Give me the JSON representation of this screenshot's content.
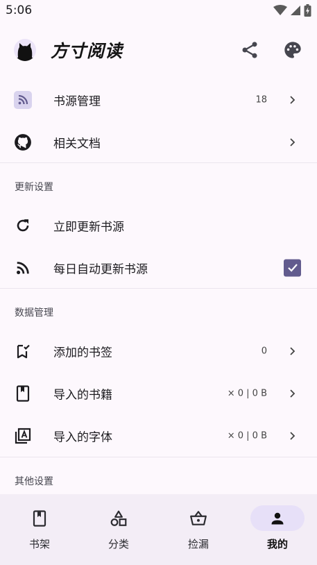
{
  "status_bar": {
    "time": "5:06"
  },
  "app": {
    "title": "方寸阅读"
  },
  "rows": {
    "book_source": {
      "label": "书源管理",
      "value": "18"
    },
    "docs": {
      "label": "相关文档"
    },
    "update_now": {
      "label": "立即更新书源"
    },
    "daily_update": {
      "label": "每日自动更新书源",
      "checked": true
    },
    "bookmarks": {
      "label": "添加的书签",
      "value": "0"
    },
    "imported_books": {
      "label": "导入的书籍",
      "value": "× 0 | 0 B"
    },
    "imported_fonts": {
      "label": "导入的字体",
      "value": "× 0 | 0 B"
    }
  },
  "sections": {
    "update": "更新设置",
    "data": "数据管理",
    "other": "其他设置"
  },
  "bottom_nav": [
    {
      "label": "书架",
      "icon": "book-icon",
      "active": false
    },
    {
      "label": "分类",
      "icon": "shapes-icon",
      "active": false
    },
    {
      "label": "捡漏",
      "icon": "basket-icon",
      "active": false
    },
    {
      "label": "我的",
      "icon": "person-icon",
      "active": true
    }
  ],
  "colors": {
    "accent": "#625b8e",
    "background": "#fdf8fd",
    "nav_background": "#f3edf6",
    "active_pill": "#e7e0f8"
  }
}
